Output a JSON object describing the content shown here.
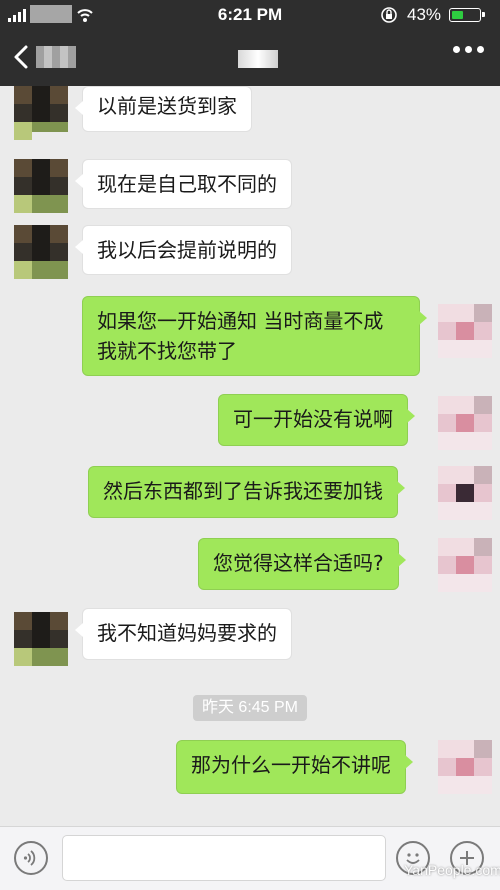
{
  "status_bar": {
    "time": "6:21 PM",
    "battery_percent": "43%",
    "battery_level": 0.43,
    "battery_color": "#2ecc40"
  },
  "title_bar": {
    "back_icon": "chevron-left-icon",
    "more_icon": "more-dots-icon"
  },
  "messages": [
    {
      "side": "left",
      "text": "以前是送货到家"
    },
    {
      "side": "left",
      "text": "现在是自己取不同的"
    },
    {
      "side": "left",
      "text": "我以后会提前说明的"
    },
    {
      "side": "right",
      "text": "如果您一开始通知 当时商量不成\n我就不找您带了"
    },
    {
      "side": "right",
      "text": "可一开始没有说啊"
    },
    {
      "side": "right",
      "text": "然后东西都到了告诉我还要加钱"
    },
    {
      "side": "right",
      "text": "您觉得这样合适吗?"
    },
    {
      "side": "left",
      "text": "我不知道妈妈要求的"
    },
    {
      "side": "right",
      "text": "那为什么一开始不讲呢"
    }
  ],
  "timestamp": "昨天 6:45 PM",
  "input_bar": {
    "voice_icon": "voice-icon",
    "emoji_icon": "emoji-icon",
    "plus_icon": "plus-icon"
  },
  "watermark": "YanPeople.com",
  "colors": {
    "header_bg": "#2e2e2e",
    "chat_bg": "#ebebeb",
    "outgoing_bubble": "#a0e75a",
    "incoming_bubble": "#ffffff"
  }
}
